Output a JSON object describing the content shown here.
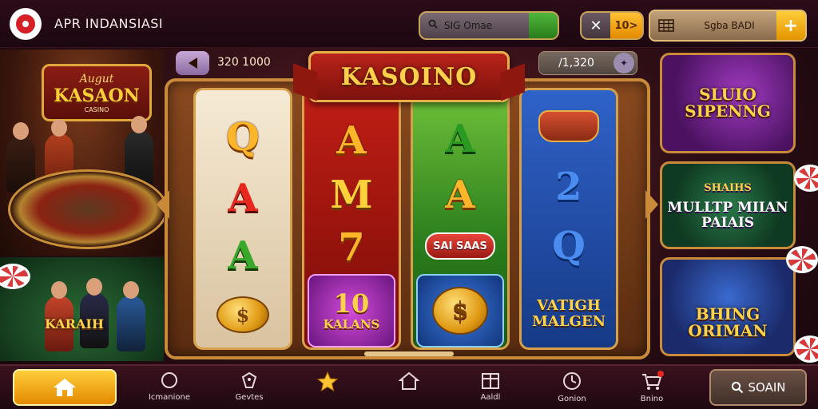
{
  "header": {
    "app_title": "APR INDANSIASI",
    "search_text": "SIG Omae",
    "coin_value": "10>",
    "balance_label": "Sgba BADI",
    "plus_label": "+"
  },
  "left_panels": {
    "top_sign_line1": "Augut",
    "top_sign_line2": "KASAON",
    "top_sign_line3": "CASINO",
    "bottom_label": "KARAIH"
  },
  "game": {
    "bet_value": "320 1000",
    "win_value": "/1,320",
    "banner_title": "KASOINO",
    "reels": [
      {
        "symbols": [
          "Q",
          "A",
          "A"
        ],
        "coin": "$"
      },
      {
        "symbols": [
          "A",
          "M",
          "7"
        ],
        "tile": "KALANS",
        "tile_num": "10"
      },
      {
        "symbols": [
          "A",
          "A"
        ],
        "badge": "SAI SAAS",
        "coin": "$"
      },
      {
        "symbols": [
          "2",
          "Q"
        ],
        "tile_text": "VATIGH MALGEN"
      }
    ]
  },
  "right_panels": [
    {
      "label": "SLUIO SIPENNG"
    },
    {
      "label": "MULLTP MIIAN PAIAIS",
      "top_label": "SHAIHS"
    },
    {
      "label": "BHING ORIMAN"
    }
  ],
  "bottom_nav": {
    "items": [
      {
        "label": "Icmanione",
        "icon": "circle-icon"
      },
      {
        "label": "Gevtes",
        "icon": "tag-icon"
      },
      {
        "label": "",
        "icon": "star-icon"
      },
      {
        "label": "",
        "icon": "home-outline-icon"
      },
      {
        "label": "Aaldl",
        "icon": "gift-icon"
      },
      {
        "label": "Gonion",
        "icon": "clock-icon"
      },
      {
        "label": "Bnino",
        "icon": "cart-icon"
      }
    ],
    "search_label": "SOAIN"
  },
  "colors": {
    "accent_gold": "#ffcd3a",
    "reel_red": "#c01e14",
    "reel_green": "#6fc13a",
    "reel_blue": "#2f62c8"
  }
}
